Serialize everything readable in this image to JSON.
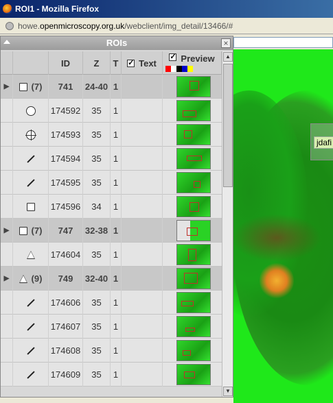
{
  "window": {
    "title": "ROI1 - Mozilla Firefox"
  },
  "url": {
    "prefix": "howe.",
    "domain": "openmicroscopy.org.uk",
    "path": "/webclient/img_detail/13466/#"
  },
  "overlay_label": "jdafi",
  "panel": {
    "title": "ROIs",
    "columns": {
      "id": "ID",
      "z": "Z",
      "t": "T",
      "text": "Text",
      "preview": "Preview"
    },
    "text_checked": true,
    "preview_checked": true,
    "swatch_colors": [
      "#ff0000",
      "#ffffff",
      "#000000",
      "#0000cc",
      "#ffff00",
      "#d0d0d0"
    ]
  },
  "rows": [
    {
      "kind": "group",
      "shape": "rect",
      "count": "(7)",
      "id": "741",
      "z": "24-40",
      "t": "1"
    },
    {
      "kind": "child",
      "shape": "ellipse",
      "id": "174592",
      "z": "35",
      "t": "1"
    },
    {
      "kind": "child",
      "shape": "point",
      "id": "174593",
      "z": "35",
      "t": "1"
    },
    {
      "kind": "child",
      "shape": "line",
      "id": "174594",
      "z": "35",
      "t": "1"
    },
    {
      "kind": "child",
      "shape": "line",
      "id": "174595",
      "z": "35",
      "t": "1"
    },
    {
      "kind": "child",
      "shape": "rect",
      "id": "174596",
      "z": "34",
      "t": "1"
    },
    {
      "kind": "group",
      "shape": "rect",
      "count": "(7)",
      "id": "747",
      "z": "32-38",
      "t": "1"
    },
    {
      "kind": "child",
      "shape": "polygon",
      "id": "174604",
      "z": "35",
      "t": "1"
    },
    {
      "kind": "group",
      "shape": "polygon",
      "count": "(9)",
      "id": "749",
      "z": "32-40",
      "t": "1"
    },
    {
      "kind": "child",
      "shape": "line",
      "id": "174606",
      "z": "35",
      "t": "1"
    },
    {
      "kind": "child",
      "shape": "line",
      "id": "174607",
      "z": "35",
      "t": "1"
    },
    {
      "kind": "child",
      "shape": "line",
      "id": "174608",
      "z": "35",
      "t": "1"
    },
    {
      "kind": "child",
      "shape": "line",
      "id": "174609",
      "z": "35",
      "t": "1"
    }
  ]
}
